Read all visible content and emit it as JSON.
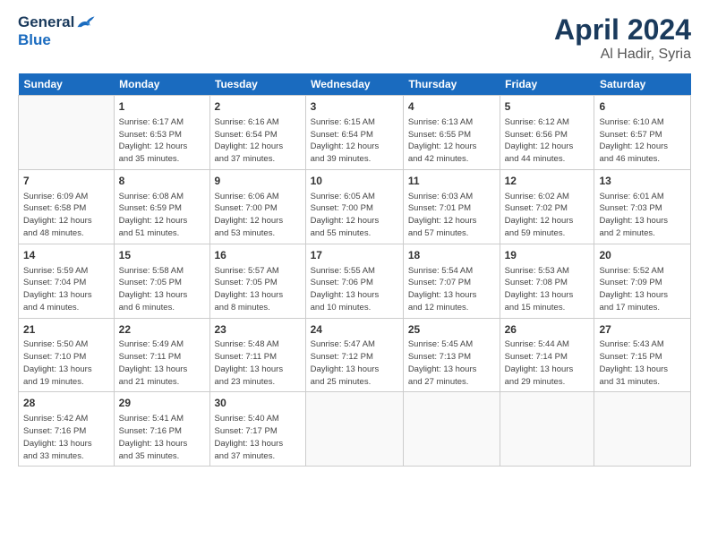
{
  "header": {
    "logo_general": "General",
    "logo_blue": "Blue",
    "month_title": "April 2024",
    "location": "Al Hadir, Syria"
  },
  "days_of_week": [
    "Sunday",
    "Monday",
    "Tuesday",
    "Wednesday",
    "Thursday",
    "Friday",
    "Saturday"
  ],
  "weeks": [
    [
      {
        "day": "",
        "info": ""
      },
      {
        "day": "1",
        "info": "Sunrise: 6:17 AM\nSunset: 6:53 PM\nDaylight: 12 hours\nand 35 minutes."
      },
      {
        "day": "2",
        "info": "Sunrise: 6:16 AM\nSunset: 6:54 PM\nDaylight: 12 hours\nand 37 minutes."
      },
      {
        "day": "3",
        "info": "Sunrise: 6:15 AM\nSunset: 6:54 PM\nDaylight: 12 hours\nand 39 minutes."
      },
      {
        "day": "4",
        "info": "Sunrise: 6:13 AM\nSunset: 6:55 PM\nDaylight: 12 hours\nand 42 minutes."
      },
      {
        "day": "5",
        "info": "Sunrise: 6:12 AM\nSunset: 6:56 PM\nDaylight: 12 hours\nand 44 minutes."
      },
      {
        "day": "6",
        "info": "Sunrise: 6:10 AM\nSunset: 6:57 PM\nDaylight: 12 hours\nand 46 minutes."
      }
    ],
    [
      {
        "day": "7",
        "info": "Sunrise: 6:09 AM\nSunset: 6:58 PM\nDaylight: 12 hours\nand 48 minutes."
      },
      {
        "day": "8",
        "info": "Sunrise: 6:08 AM\nSunset: 6:59 PM\nDaylight: 12 hours\nand 51 minutes."
      },
      {
        "day": "9",
        "info": "Sunrise: 6:06 AM\nSunset: 7:00 PM\nDaylight: 12 hours\nand 53 minutes."
      },
      {
        "day": "10",
        "info": "Sunrise: 6:05 AM\nSunset: 7:00 PM\nDaylight: 12 hours\nand 55 minutes."
      },
      {
        "day": "11",
        "info": "Sunrise: 6:03 AM\nSunset: 7:01 PM\nDaylight: 12 hours\nand 57 minutes."
      },
      {
        "day": "12",
        "info": "Sunrise: 6:02 AM\nSunset: 7:02 PM\nDaylight: 12 hours\nand 59 minutes."
      },
      {
        "day": "13",
        "info": "Sunrise: 6:01 AM\nSunset: 7:03 PM\nDaylight: 13 hours\nand 2 minutes."
      }
    ],
    [
      {
        "day": "14",
        "info": "Sunrise: 5:59 AM\nSunset: 7:04 PM\nDaylight: 13 hours\nand 4 minutes."
      },
      {
        "day": "15",
        "info": "Sunrise: 5:58 AM\nSunset: 7:05 PM\nDaylight: 13 hours\nand 6 minutes."
      },
      {
        "day": "16",
        "info": "Sunrise: 5:57 AM\nSunset: 7:05 PM\nDaylight: 13 hours\nand 8 minutes."
      },
      {
        "day": "17",
        "info": "Sunrise: 5:55 AM\nSunset: 7:06 PM\nDaylight: 13 hours\nand 10 minutes."
      },
      {
        "day": "18",
        "info": "Sunrise: 5:54 AM\nSunset: 7:07 PM\nDaylight: 13 hours\nand 12 minutes."
      },
      {
        "day": "19",
        "info": "Sunrise: 5:53 AM\nSunset: 7:08 PM\nDaylight: 13 hours\nand 15 minutes."
      },
      {
        "day": "20",
        "info": "Sunrise: 5:52 AM\nSunset: 7:09 PM\nDaylight: 13 hours\nand 17 minutes."
      }
    ],
    [
      {
        "day": "21",
        "info": "Sunrise: 5:50 AM\nSunset: 7:10 PM\nDaylight: 13 hours\nand 19 minutes."
      },
      {
        "day": "22",
        "info": "Sunrise: 5:49 AM\nSunset: 7:11 PM\nDaylight: 13 hours\nand 21 minutes."
      },
      {
        "day": "23",
        "info": "Sunrise: 5:48 AM\nSunset: 7:11 PM\nDaylight: 13 hours\nand 23 minutes."
      },
      {
        "day": "24",
        "info": "Sunrise: 5:47 AM\nSunset: 7:12 PM\nDaylight: 13 hours\nand 25 minutes."
      },
      {
        "day": "25",
        "info": "Sunrise: 5:45 AM\nSunset: 7:13 PM\nDaylight: 13 hours\nand 27 minutes."
      },
      {
        "day": "26",
        "info": "Sunrise: 5:44 AM\nSunset: 7:14 PM\nDaylight: 13 hours\nand 29 minutes."
      },
      {
        "day": "27",
        "info": "Sunrise: 5:43 AM\nSunset: 7:15 PM\nDaylight: 13 hours\nand 31 minutes."
      }
    ],
    [
      {
        "day": "28",
        "info": "Sunrise: 5:42 AM\nSunset: 7:16 PM\nDaylight: 13 hours\nand 33 minutes."
      },
      {
        "day": "29",
        "info": "Sunrise: 5:41 AM\nSunset: 7:16 PM\nDaylight: 13 hours\nand 35 minutes."
      },
      {
        "day": "30",
        "info": "Sunrise: 5:40 AM\nSunset: 7:17 PM\nDaylight: 13 hours\nand 37 minutes."
      },
      {
        "day": "",
        "info": ""
      },
      {
        "day": "",
        "info": ""
      },
      {
        "day": "",
        "info": ""
      },
      {
        "day": "",
        "info": ""
      }
    ]
  ]
}
